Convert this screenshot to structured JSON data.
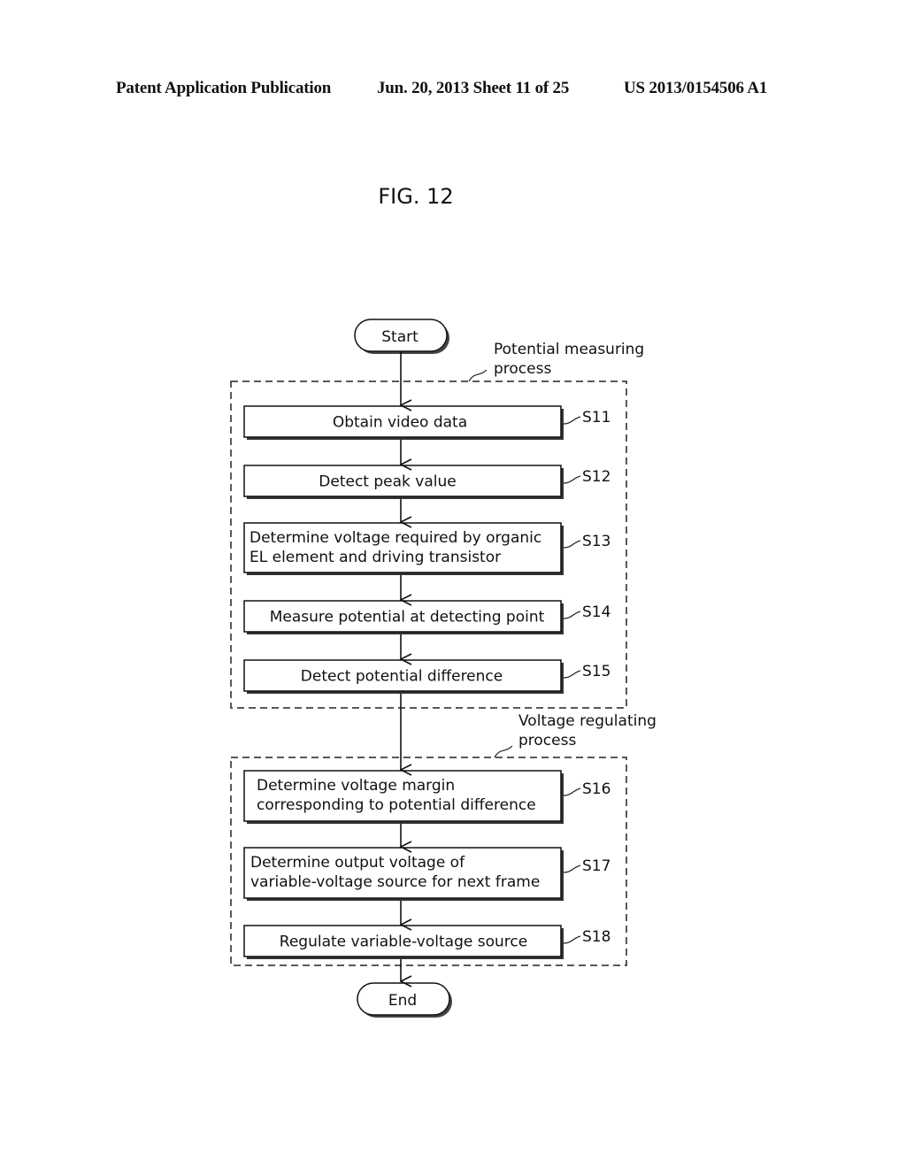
{
  "header": {
    "publication": "Patent Application Publication",
    "date_sheet": "Jun. 20, 2013  Sheet 11 of 25",
    "patent_number": "US 2013/0154506 A1"
  },
  "figure": {
    "title": "FIG. 12",
    "start_label": "Start",
    "end_label": "End",
    "groups": [
      {
        "label_line1": "Potential measuring",
        "label_line2": "process"
      },
      {
        "label_line1": "Voltage regulating",
        "label_line2": "process"
      }
    ],
    "steps": [
      {
        "id": "S11",
        "lines": [
          "Obtain video data"
        ]
      },
      {
        "id": "S12",
        "lines": [
          "Detect peak value"
        ]
      },
      {
        "id": "S13",
        "lines": [
          "Determine voltage required by organic",
          "EL element and driving transistor"
        ]
      },
      {
        "id": "S14",
        "lines": [
          "Measure potential at detecting point"
        ]
      },
      {
        "id": "S15",
        "lines": [
          "Detect potential difference"
        ]
      },
      {
        "id": "S16",
        "lines": [
          "Determine voltage margin",
          "corresponding to potential difference"
        ]
      },
      {
        "id": "S17",
        "lines": [
          "Determine output voltage of",
          "variable-voltage source for next frame"
        ]
      },
      {
        "id": "S18",
        "lines": [
          "Regulate variable-voltage source"
        ]
      }
    ]
  }
}
